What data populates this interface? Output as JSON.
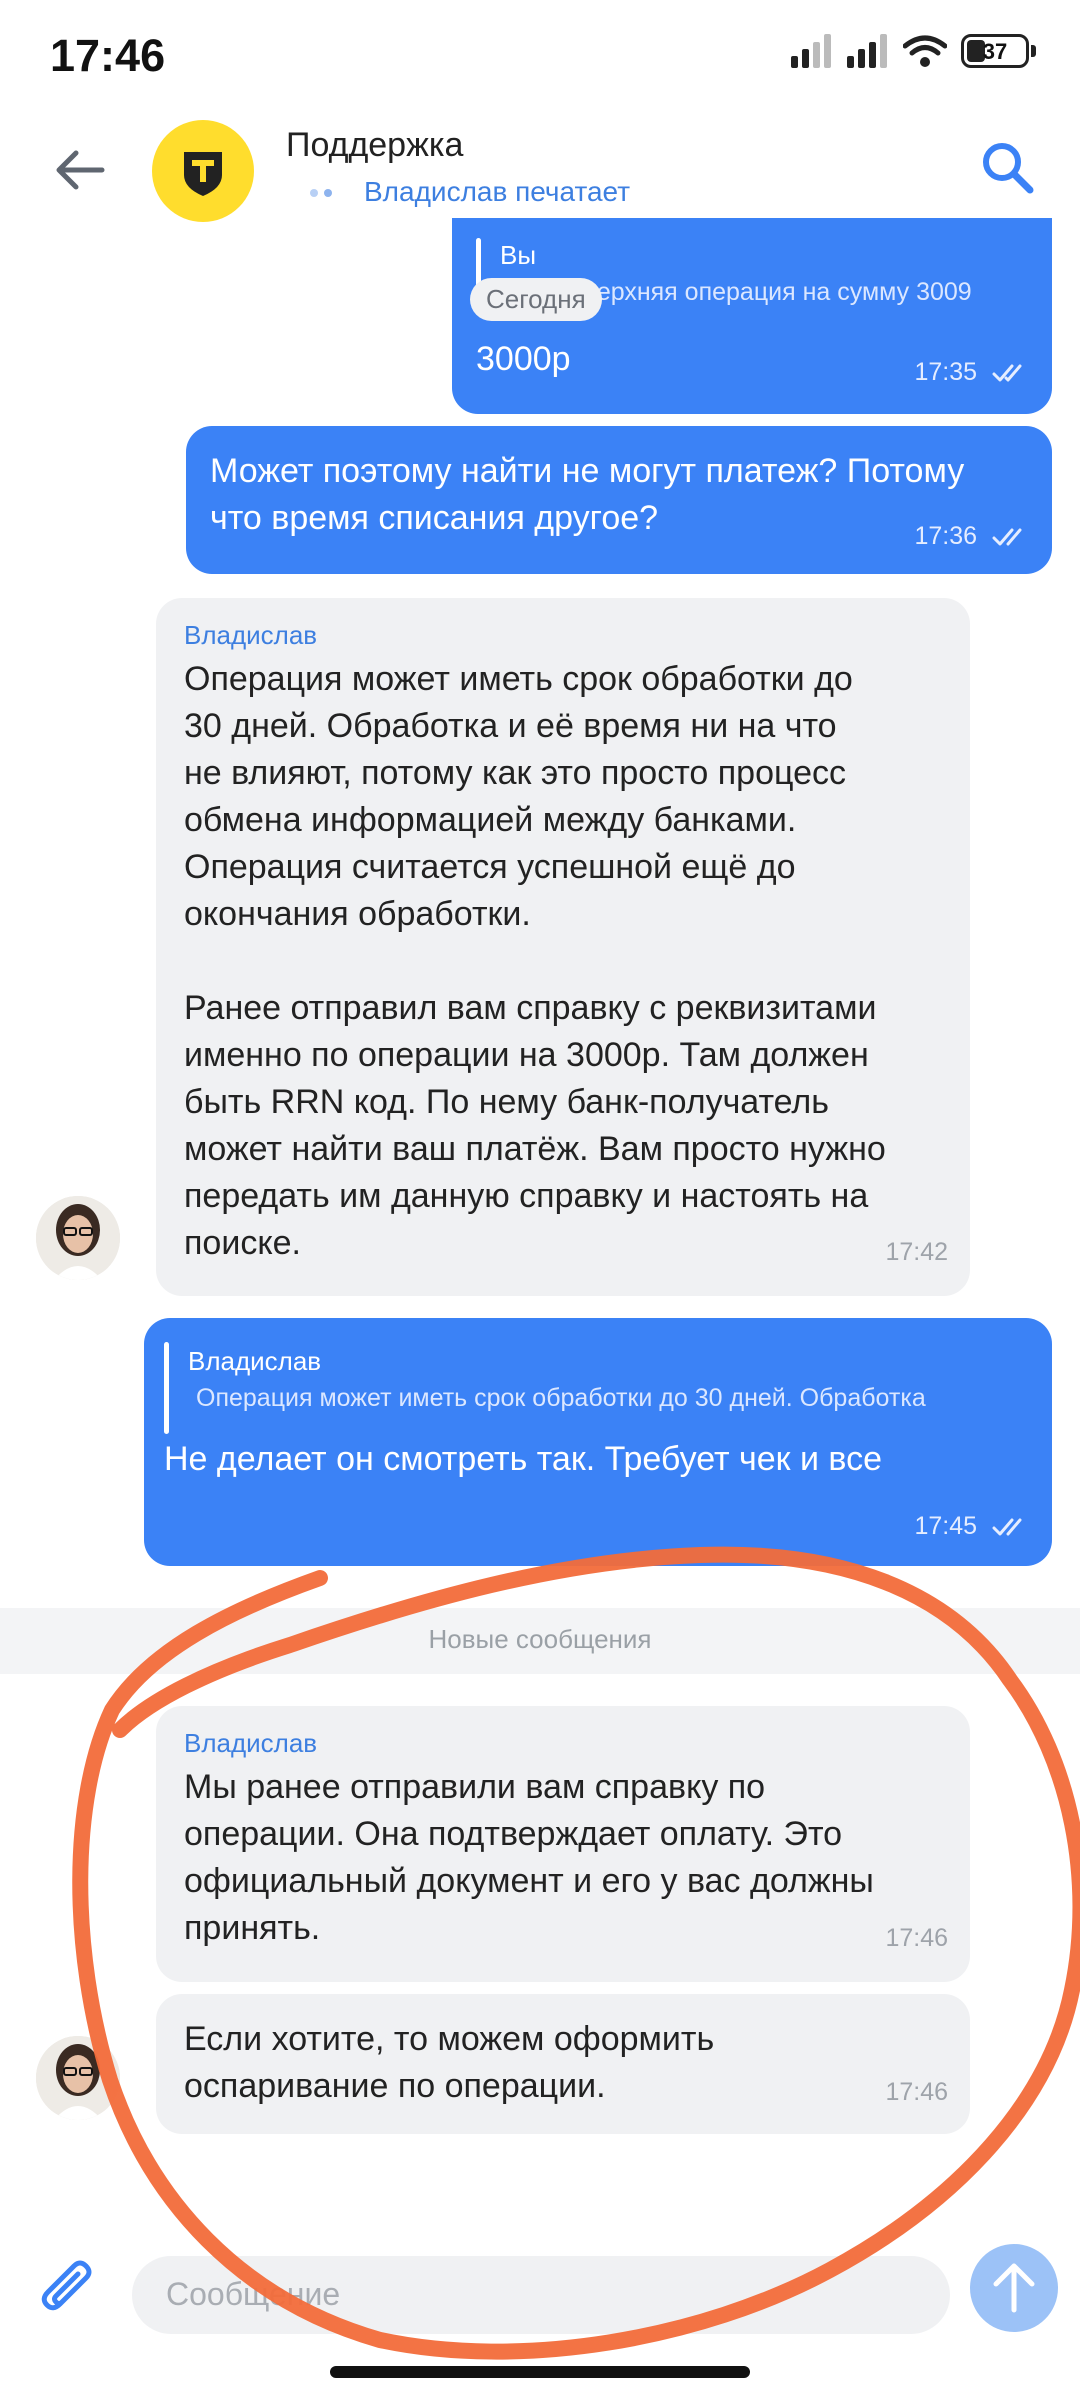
{
  "status_bar": {
    "time": "17:46",
    "battery": "37"
  },
  "header": {
    "title": "Поддержка",
    "typing_status": "Владислав печатает"
  },
  "date_pill": "Сегодня",
  "messages": [
    {
      "quote_name": "Вы",
      "quote_text": "Самая верхняя операция на сумму 3009",
      "text": "3000р",
      "time": "17:35"
    },
    {
      "text": "Может поэтому найти не могут платеж? Потому\nчто время списания другое?",
      "time": "17:36"
    },
    {
      "sender": "Владислав",
      "text": "Операция может иметь срок обработки до\n30 дней. Обработка и её время ни на что\nне влияют, потому как это просто процесс\nобмена информацией между банками.\nОперация считается успешной ещё до\nокончания обработки.\n\nРанее отправил вам справку с реквизитами\nименно по операции на 3000р. Там должен\nбыть RRN код. По нему банк-получатель\nможет найти ваш платёж. Вам просто нужно\nпередать им данную справку и настоять на\nпоиске.",
      "time": "17:42"
    },
    {
      "quote_name": "Владислав",
      "quote_text": "Операция может иметь срок обработки до 30 дней. Обработка",
      "text": "Не делает он смотреть так. Требует чек и все",
      "time": "17:45"
    },
    {
      "sender": "Владислав",
      "text": "Мы ранее отправили вам справку по\nоперации. Она подтверждает оплату. Это\nофициальный документ и его у вас должны\nпринять.",
      "time": "17:46"
    },
    {
      "text": "Если хотите, то можем оформить\nоспаривание по операции.",
      "time": "17:46"
    }
  ],
  "new_messages_label": "Новые сообщения",
  "composer": {
    "placeholder": "Сообщение"
  },
  "colors": {
    "accent": "#3b82f6",
    "incoming_bubble": "#f0f1f3",
    "logo": "#ffdd2d",
    "annotation": "#f26b3a"
  }
}
